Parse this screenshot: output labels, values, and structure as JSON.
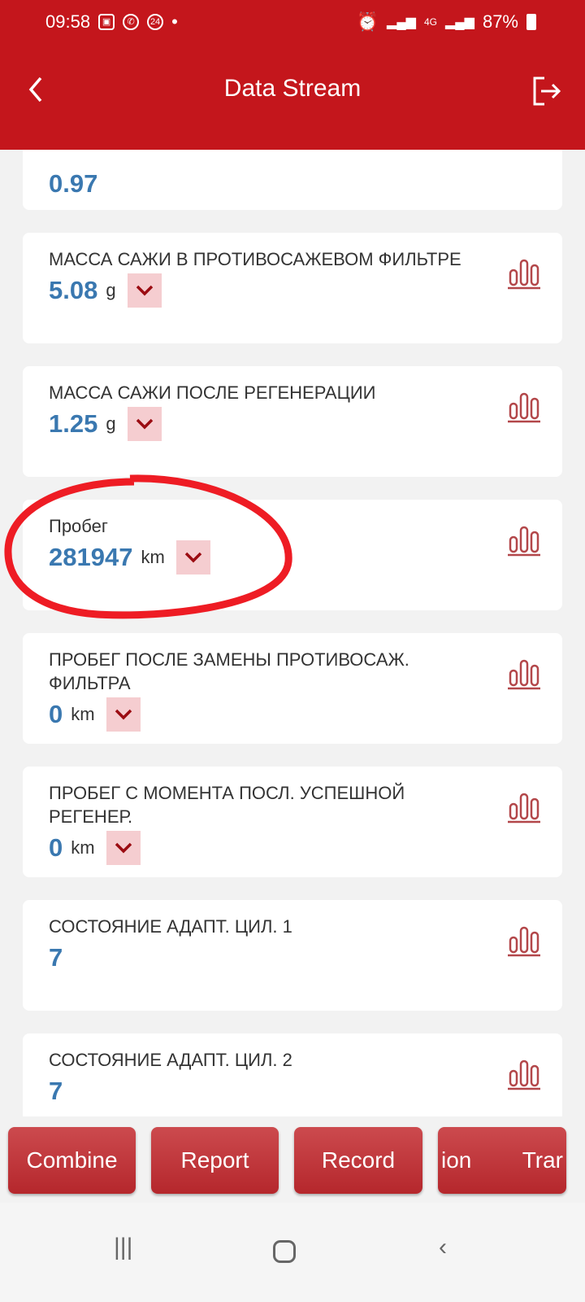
{
  "status_bar": {
    "time": "09:58",
    "battery": "87%",
    "network": "4G"
  },
  "header": {
    "title": "Data Stream",
    "back_icon": "chevron-left-icon",
    "exit_icon": "exit-icon"
  },
  "colors": {
    "header": "#c4161c",
    "value": "#3a78b0",
    "dropdown_bg": "#f5cdd0",
    "chart_icon": "#b3474a"
  },
  "items": [
    {
      "label": "",
      "value": "0.97",
      "unit": "",
      "dropdown": false
    },
    {
      "label": "МАССА САЖИ В ПРОТИВОСАЖЕВОМ ФИЛЬТРЕ",
      "value": "5.08",
      "unit": "g",
      "dropdown": true
    },
    {
      "label": "МАССА САЖИ ПОСЛЕ РЕГЕНЕРАЦИИ",
      "value": "1.25",
      "unit": "g",
      "dropdown": true
    },
    {
      "label": "Пробег",
      "value": "281947",
      "unit": "km",
      "dropdown": true
    },
    {
      "label": "ПРОБЕГ ПОСЛЕ ЗАМЕНЫ ПРОТИВОСАЖ. ФИЛЬТРА",
      "value": "0",
      "unit": "km",
      "dropdown": true
    },
    {
      "label": "ПРОБЕГ С МОМЕНТА ПОСЛ. УСПЕШНОЙ РЕГЕНЕР.",
      "value": "0",
      "unit": "km",
      "dropdown": true
    },
    {
      "label": "СОСТОЯНИЕ АДАПТ. ЦИЛ. 1",
      "value": "7",
      "unit": "",
      "dropdown": false
    },
    {
      "label": "СОСТОЯНИЕ АДАПТ. ЦИЛ. 2",
      "value": "7",
      "unit": "",
      "dropdown": false
    }
  ],
  "buttons": {
    "combine": "Combine",
    "report": "Report",
    "record": "Record",
    "fourth_left": "ion",
    "fourth_right": "Trar"
  }
}
